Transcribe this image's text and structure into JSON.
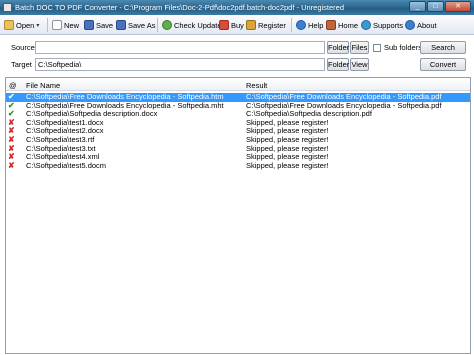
{
  "window": {
    "title": "Batch DOC TO PDF Converter - C:\\Program Files\\Doc-2-Pdf\\doc2pdf.batch-doc2pdf - Unregistered",
    "controls": [
      "_",
      "□",
      "✕"
    ]
  },
  "toolbar": {
    "open": "Open",
    "new": "New",
    "save": "Save",
    "save_as": "Save As",
    "check_update": "Check Update",
    "buy": "Buy",
    "register": "Register",
    "help": "Help",
    "home": "Home",
    "supports": "Supports",
    "about": "About",
    "dropdown_caret": "▾"
  },
  "source": {
    "label": "Source",
    "value": "",
    "folder_button": "Folder",
    "files_button": "Files",
    "subfolders_label": "Sub folders",
    "search_button": "Search"
  },
  "target": {
    "label": "Target",
    "value": "C:\\Softpedia\\",
    "folder_button": "Folder",
    "view_button": "View",
    "convert_button": "Convert"
  },
  "table": {
    "columns": [
      "@",
      "File Name",
      "Result"
    ],
    "rows": [
      {
        "status": "ok",
        "file": "C:\\Softpedia\\Free Downloads Encyclopedia - Softpedia.htm",
        "result": "C:\\Softpedia\\Free Downloads Encyclopedia - Softpedia.pdf"
      },
      {
        "status": "ok",
        "file": "C:\\Softpedia\\Free Downloads Encyclopedia - Softpedia.mht",
        "result": "C:\\Softpedia\\Free Downloads Encyclopedia - Softpedia.pdf"
      },
      {
        "status": "ok",
        "file": "C:\\Softpedia\\Softpedia description.docx",
        "result": "C:\\Softpedia\\Softpedia description.pdf"
      },
      {
        "status": "err",
        "file": "C:\\Softpedia\\test1.docx",
        "result": "Skipped, please register!"
      },
      {
        "status": "err",
        "file": "C:\\Softpedia\\test2.docx",
        "result": "Skipped, please register!"
      },
      {
        "status": "err",
        "file": "C:\\Softpedia\\test3.rtf",
        "result": "Skipped, please register!"
      },
      {
        "status": "err",
        "file": "C:\\Softpedia\\test3.txt",
        "result": "Skipped, please register!"
      },
      {
        "status": "err",
        "file": "C:\\Softpedia\\test4.xml",
        "result": "Skipped, please register!"
      },
      {
        "status": "err",
        "file": "C:\\Softpedia\\test5.docm",
        "result": "Skipped, please register!"
      }
    ],
    "selected_row": 0,
    "status_glyphs": {
      "ok": "✔",
      "err": "✘"
    }
  },
  "colors": {
    "selection": "#3399ff",
    "ok": "#2a9a2a",
    "err": "#d02a2a",
    "titlebar": "#2f6a92"
  }
}
